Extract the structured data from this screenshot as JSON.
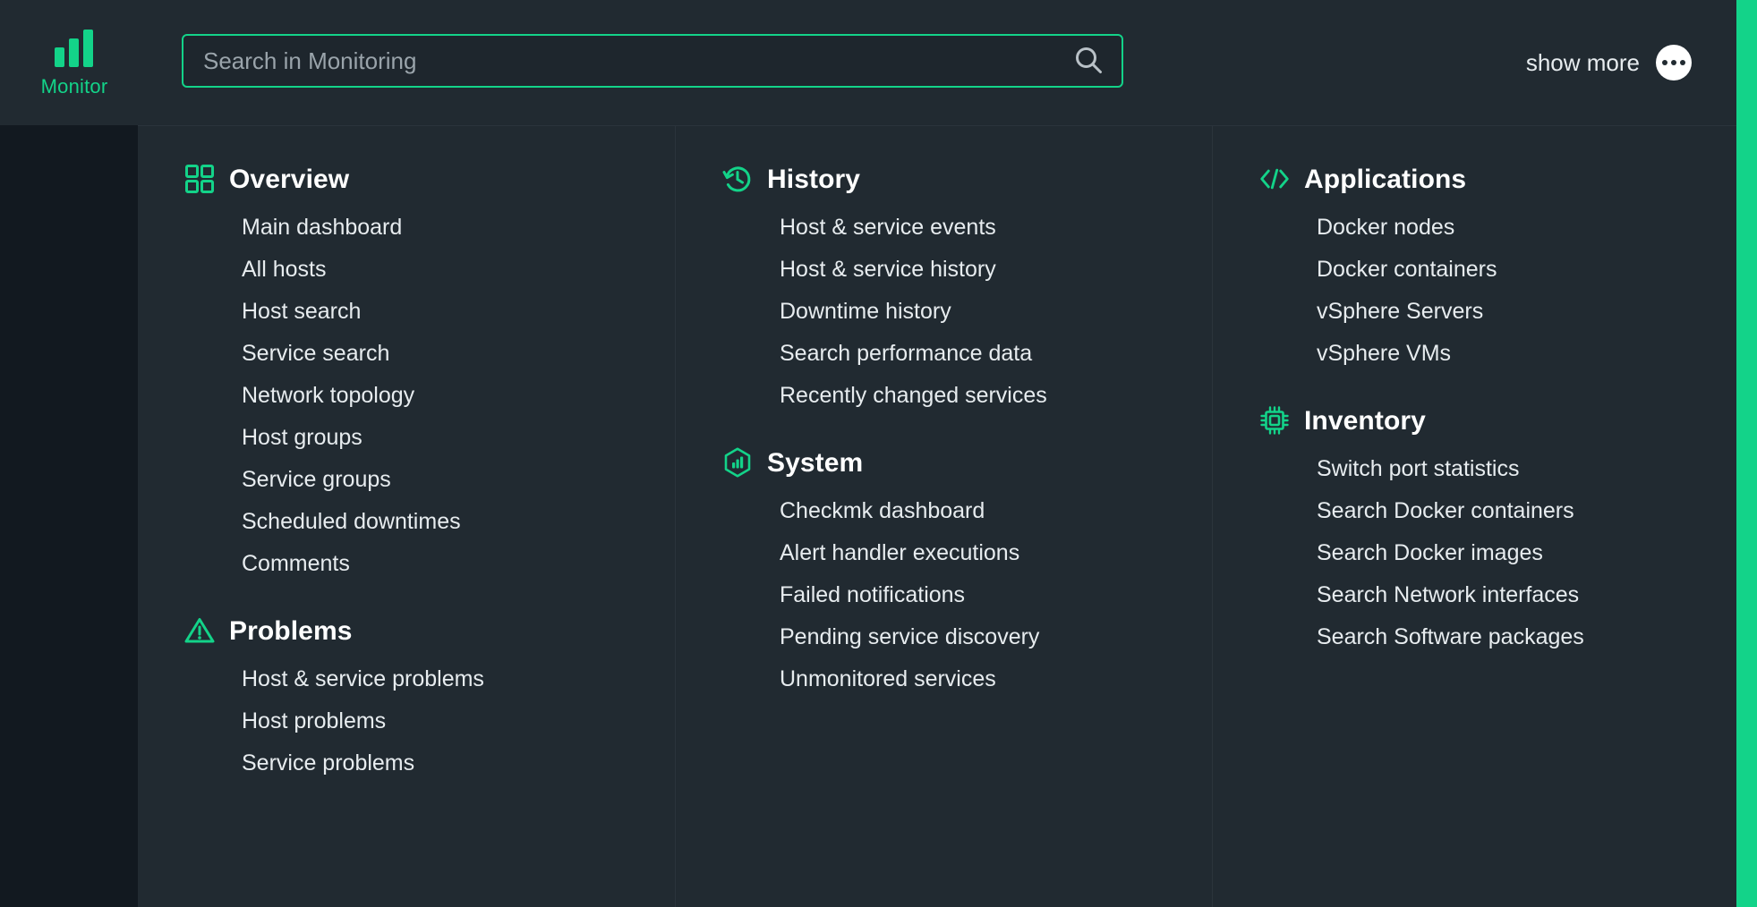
{
  "brand": {
    "label": "Monitor",
    "icon": "bar-chart-icon"
  },
  "search": {
    "placeholder": "Search in Monitoring",
    "value": "",
    "icon": "search-icon"
  },
  "header": {
    "show_more_label": "show more",
    "show_more_icon": "ellipsis-icon"
  },
  "theme": {
    "accent": "#13d389",
    "background": "#212a31",
    "sidebar": "#121920",
    "text": "#e7ecef",
    "divider": "#2b343c"
  },
  "columns": [
    {
      "groups": [
        {
          "title": "Overview",
          "icon": "grid-icon",
          "items": [
            "Main dashboard",
            "All hosts",
            "Host search",
            "Service search",
            "Network topology",
            "Host groups",
            "Service groups",
            "Scheduled downtimes",
            "Comments"
          ]
        },
        {
          "title": "Problems",
          "icon": "warning-triangle-icon",
          "items": [
            "Host & service problems",
            "Host problems",
            "Service problems"
          ]
        }
      ]
    },
    {
      "groups": [
        {
          "title": "History",
          "icon": "clock-history-icon",
          "items": [
            "Host & service events",
            "Host & service history",
            "Downtime history",
            "Search performance data",
            "Recently changed services"
          ]
        },
        {
          "title": "System",
          "icon": "hexagon-chart-icon",
          "items": [
            "Checkmk dashboard",
            "Alert handler executions",
            "Failed notifications",
            "Pending service discovery",
            "Unmonitored services"
          ]
        }
      ]
    },
    {
      "groups": [
        {
          "title": "Applications",
          "icon": "code-brackets-icon",
          "items": [
            "Docker nodes",
            "Docker containers",
            "vSphere Servers",
            "vSphere VMs"
          ]
        },
        {
          "title": "Inventory",
          "icon": "cpu-chip-icon",
          "items": [
            "Switch port statistics",
            "Search Docker containers",
            "Search Docker images",
            "Search Network interfaces",
            "Search Software packages"
          ]
        }
      ]
    }
  ]
}
